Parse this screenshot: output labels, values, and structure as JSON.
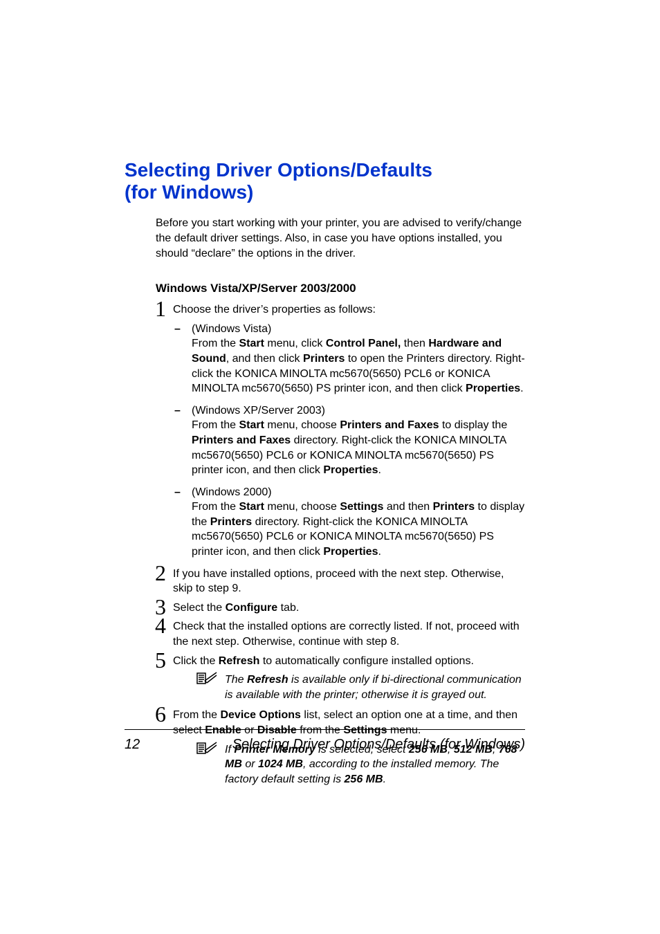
{
  "heading_line1": "Selecting Driver Options/Defaults",
  "heading_line2": "(for Windows)",
  "intro": "Before you start working with your printer, you are advised to verify/change the default driver settings. Also, in case you have options installed, you should “declare” the options in the driver.",
  "subheading": "Windows Vista/XP/Server 2003/2000",
  "steps": {
    "s1": {
      "num": "1",
      "text": "Choose the driver’s properties as follows:"
    },
    "sub": {
      "vista": {
        "label": "(Windows Vista)",
        "l1a": "From the ",
        "l1b": "Start",
        "l1c": " menu, click ",
        "l1d": "Control Panel,",
        "l1e": " then ",
        "l1f": "Hardware and Sound",
        "l1g": ", and then click ",
        "l1h": "Printers",
        "l1i": " to open the Printers directory. Right-click the KONICA MINOLTA mc5670(5650) PCL6 or KONICA MINOLTA mc5670(5650) PS printer icon, and then click ",
        "l1j": "Properties",
        "l1k": "."
      },
      "xp": {
        "label": "(Windows XP/Server 2003)",
        "l1a": "From the ",
        "l1b": "Start",
        "l1c": " menu, choose ",
        "l1d": "Printers and Faxes",
        "l1e": " to display the ",
        "l2a": "Printers and Faxes",
        "l2b": " directory. Right-click the KONICA MINOLTA mc5670(5650) PCL6 or KONICA MINOLTA mc5670(5650) PS printer icon, and then click ",
        "l2c": "Properties",
        "l2d": "."
      },
      "w2k": {
        "label": "(Windows 2000)",
        "l1a": "From the ",
        "l1b": "Start",
        "l1c": " menu, choose ",
        "l1d": "Settings",
        "l1e": " and then ",
        "l1f": "Printers",
        "l1g": " to display the ",
        "l1h": "Printers",
        "l1i": " directory. Right-click the KONICA MINOLTA mc5670(5650) PCL6 or KONICA MINOLTA mc5670(5650) PS printer icon, and then click ",
        "l1j": "Properties",
        "l1k": "."
      }
    },
    "s2": {
      "num": "2",
      "text": "If you have installed options, proceed with the next step. Otherwise, skip to step 9."
    },
    "s3": {
      "num": "3",
      "a": "Select the ",
      "b": "Configure",
      "c": " tab."
    },
    "s4": {
      "num": "4",
      "text": "Check that the installed options are correctly listed. If not, proceed with the next step. Otherwise, continue with step 8."
    },
    "s5": {
      "num": "5",
      "a": "Click the ",
      "b": "Refresh",
      "c": " to automatically configure installed options."
    },
    "note1": {
      "a": "The ",
      "b": "Refresh",
      "c": " is available only if bi-directional communication is available with the printer; otherwise it is grayed out."
    },
    "s6": {
      "num": "6",
      "a": "From the ",
      "b": "Device Options",
      "c": " list, select an option one at a time, and then select ",
      "d": "Enable",
      "e": " or ",
      "f": "Disable",
      "g": " from the ",
      "h": "Settings",
      "i": " menu."
    },
    "note2": {
      "a": "If ",
      "b": "Printer Memory",
      "c": " is selected, select ",
      "d": "256 MB",
      "e": ", ",
      "f": "512 MB",
      "g": ", ",
      "h": "768 MB",
      "i": " or ",
      "j": "1024 MB",
      "k": ", according to the installed memory. The factory default setting is ",
      "l": "256 MB",
      "m": "."
    }
  },
  "footer": {
    "page": "12",
    "title": "Selecting Driver Options/Defaults (for Windows)"
  }
}
